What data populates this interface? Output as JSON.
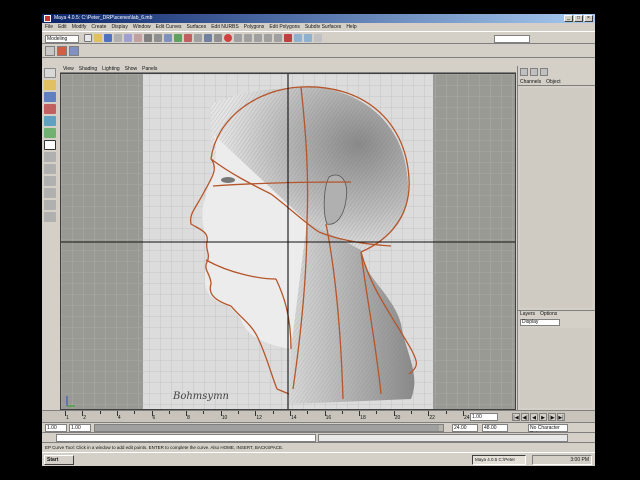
{
  "window": {
    "title": "Maya 4.0.5: C:\\Peter_DRP\\scenes\\lab_6.mb"
  },
  "menubar": [
    "File",
    "Edit",
    "Modify",
    "Create",
    "Display",
    "Window",
    "Edit Curves",
    "Surfaces",
    "Edit NURBS",
    "Polygons",
    "Edit Polygons",
    "Subdiv Surfaces",
    "Help"
  ],
  "statusline": {
    "mode": "Modeling"
  },
  "panel_menu": [
    "View",
    "Shading",
    "Lighting",
    "Show",
    "Panels"
  ],
  "viewport": {
    "signature": "Bohmsymn",
    "grid_labels": [
      "0",
      "2",
      "4",
      "6",
      "8",
      "10",
      "12",
      "14",
      "16",
      "18",
      "20",
      "22",
      "24"
    ]
  },
  "channel_box": {
    "menu": [
      "Channels",
      "Object"
    ]
  },
  "layers": {
    "menu": [
      "Layers",
      "Options"
    ],
    "display_option": "Display"
  },
  "time_slider": {
    "labels": [
      "1",
      "2",
      "4",
      "6",
      "8",
      "10",
      "12",
      "14",
      "16",
      "18",
      "20",
      "22",
      "24"
    ],
    "current_frame": "1.00"
  },
  "range_slider": {
    "start": "1.00",
    "end": "24.00",
    "anim_end": "48.00",
    "character_set": "No Character Set"
  },
  "playback_buttons": [
    "|◀",
    "◀|",
    "◀",
    "▶",
    "|▶",
    "▶|"
  ],
  "help_line": "EP Curve Tool: Click in a window to add edit points. ENTER to complete the curve. Also HOME, INSERT, BACKSPACE.",
  "taskbar": {
    "start_label": "Start",
    "task_label": "Maya 4.0.5 C:\\Peter",
    "clock": "3:00 PM"
  },
  "colors": {
    "curve": "#b5552a",
    "grid_bg": "#d8d8d8",
    "grid_line": "#a8a8a8",
    "title_bar": "#0a246a"
  }
}
